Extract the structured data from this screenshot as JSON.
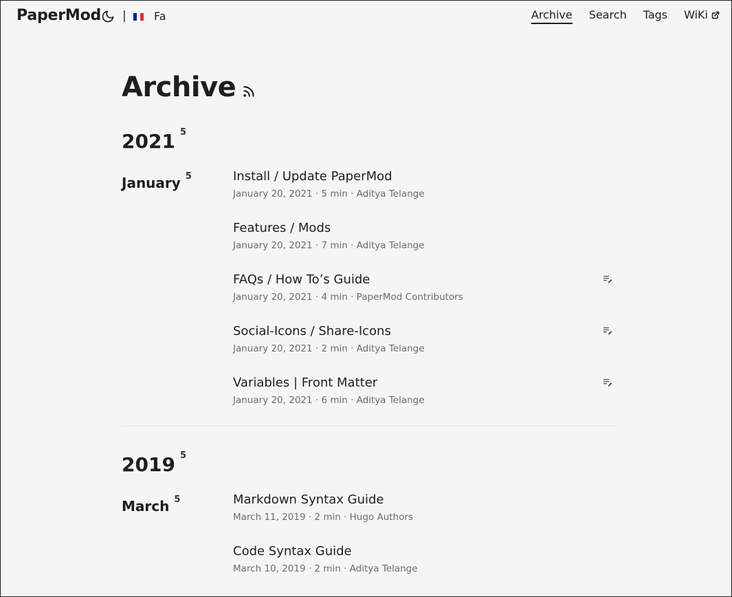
{
  "header": {
    "logo": "PaperMod",
    "separator": "|",
    "language": "Fa",
    "flag_colors": [
      "#002395",
      "#ffffff",
      "#ed2939"
    ],
    "theme_icon": "moon-icon",
    "menu": [
      {
        "label": "Archive",
        "active": true
      },
      {
        "label": "Search"
      },
      {
        "label": "Tags"
      },
      {
        "label": "WiKi",
        "icon": "external-link-icon"
      }
    ]
  },
  "page": {
    "title": "Archive",
    "rss_icon": "rss-icon"
  },
  "years": [
    {
      "year": "2021",
      "count": "5",
      "months": [
        {
          "month": "January",
          "count": "5",
          "posts": [
            {
              "title": "Install / Update PaperMod",
              "meta": "January 20, 2021 · 5 min · Aditya Telange",
              "draft": false
            },
            {
              "title": "Features / Mods",
              "meta": "January 20, 2021 · 7 min · Aditya Telange",
              "draft": false
            },
            {
              "title": "FAQs / How To’s Guide",
              "meta": "January 20, 2021 · 4 min · PaperMod Contributors",
              "draft": true
            },
            {
              "title": "Social-Icons / Share-Icons",
              "meta": "January 20, 2021 · 2 min · Aditya Telange",
              "draft": true
            },
            {
              "title": "Variables | Front Matter",
              "meta": "January 20, 2021 · 6 min · Aditya Telange",
              "draft": true
            }
          ]
        }
      ]
    },
    {
      "year": "2019",
      "count": "5",
      "months": [
        {
          "month": "March",
          "count": "5",
          "posts": [
            {
              "title": "Markdown Syntax Guide",
              "meta": "March 11, 2019 · 2 min · Hugo Authors",
              "draft": false
            },
            {
              "title": "Code Syntax Guide",
              "meta": "March 10, 2019 · 2 min · Aditya Telange",
              "draft": false
            }
          ]
        }
      ]
    }
  ]
}
